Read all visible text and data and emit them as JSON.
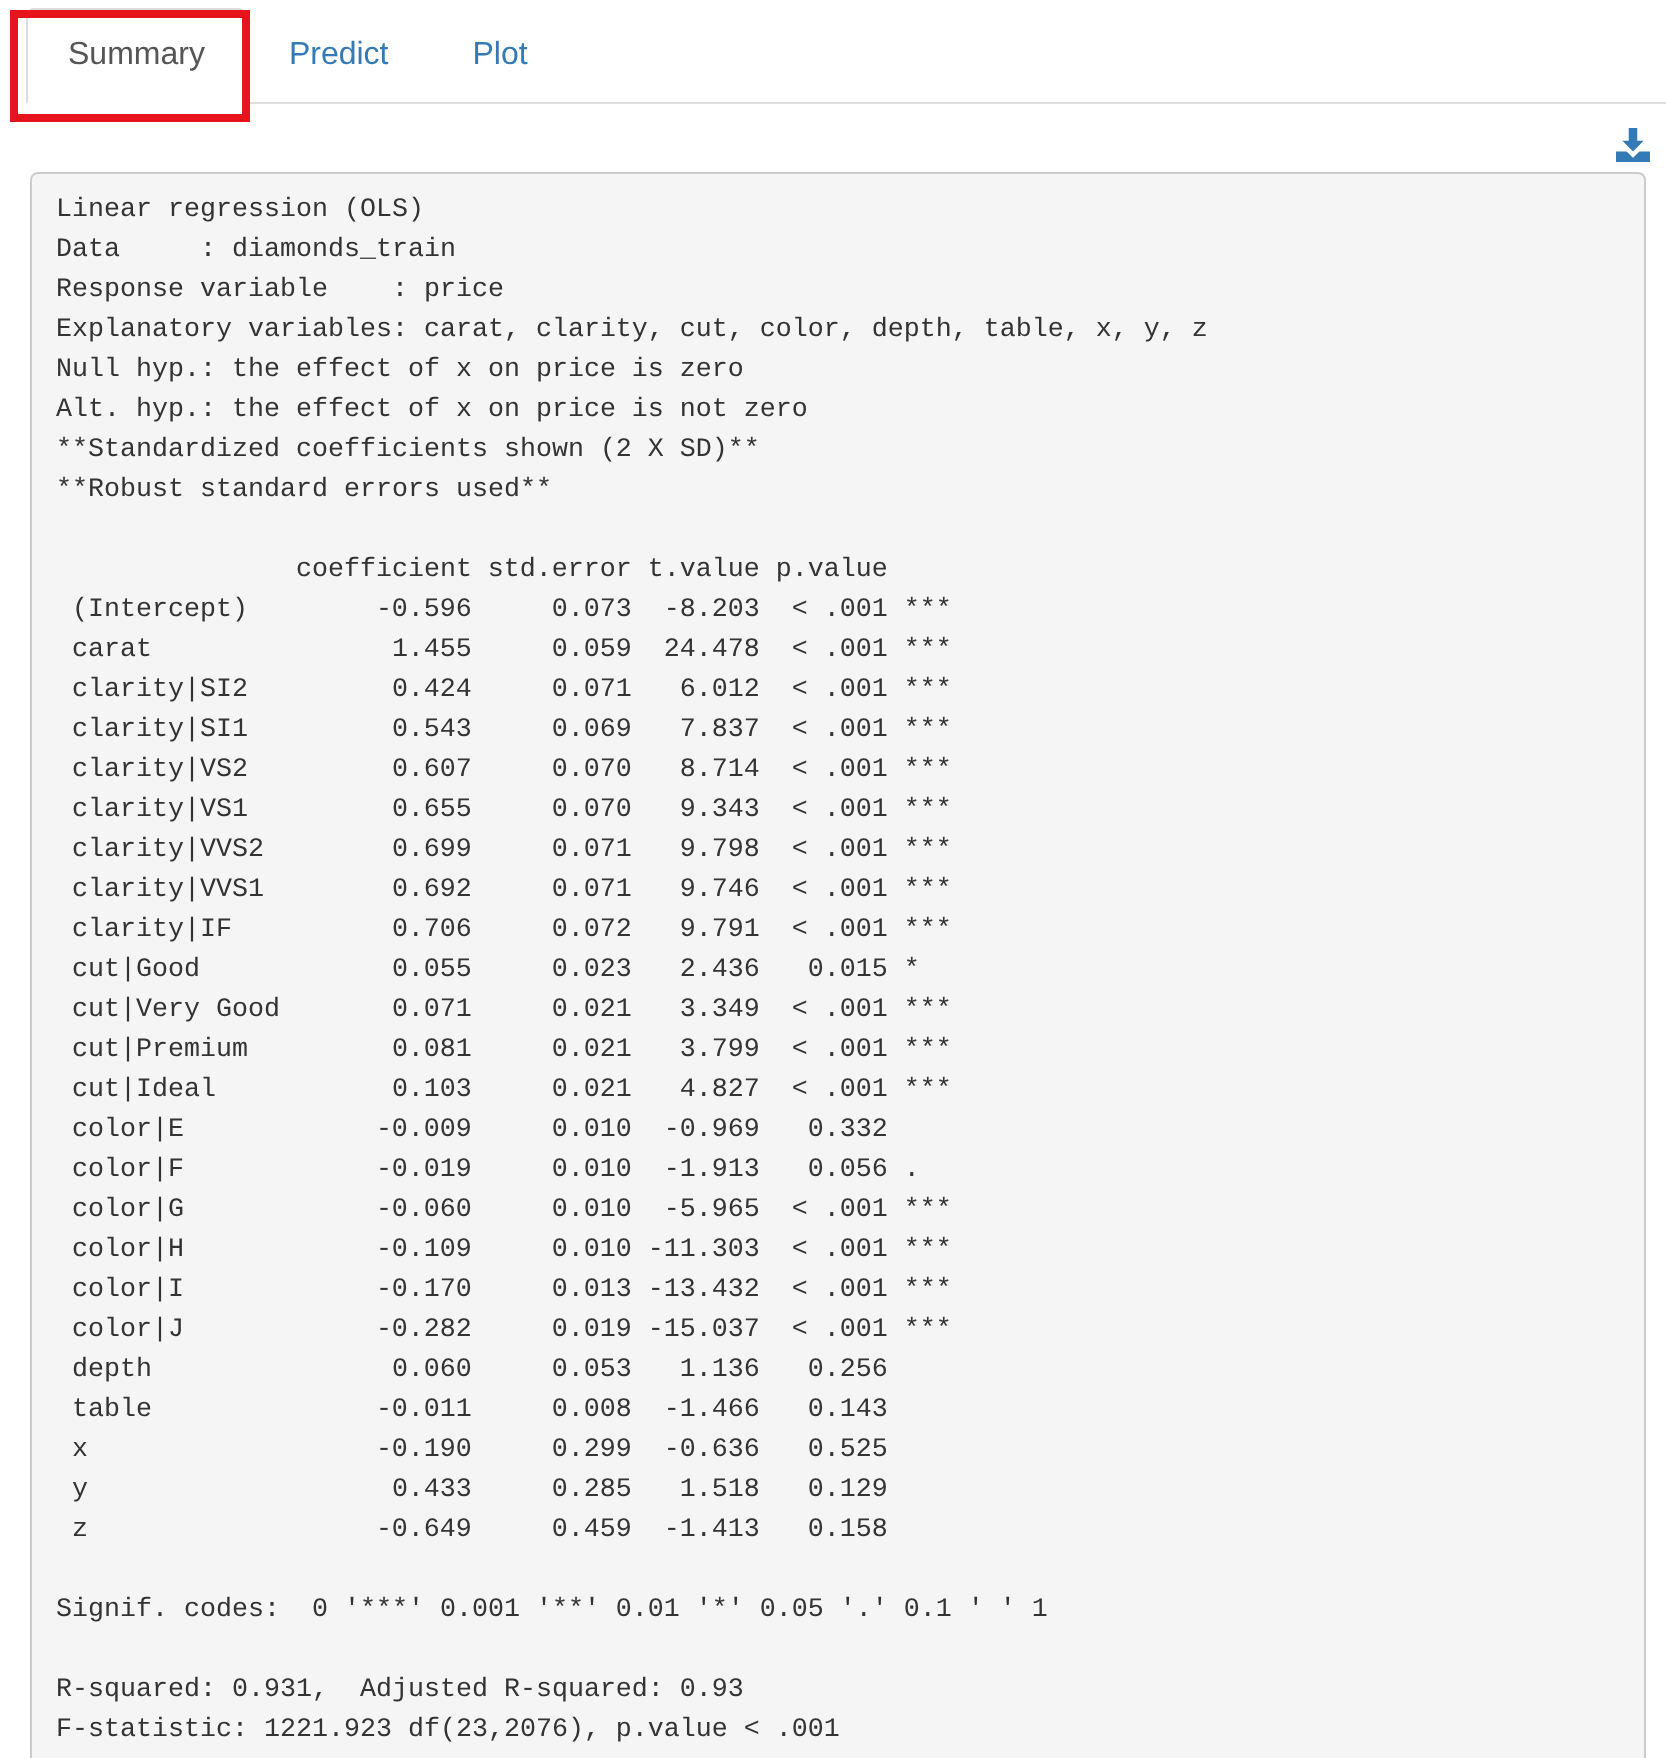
{
  "tabs": [
    {
      "label": "Summary",
      "selected": true,
      "highlighted": true
    },
    {
      "label": "Predict",
      "selected": false,
      "highlighted": false
    },
    {
      "label": "Plot",
      "selected": false,
      "highlighted": false
    }
  ],
  "output": {
    "header_lines": [
      "Linear regression (OLS)",
      "Data     : diamonds_train",
      "Response variable    : price",
      "Explanatory variables: carat, clarity, cut, color, depth, table, x, y, z",
      "Null hyp.: the effect of x on price is zero",
      "Alt. hyp.: the effect of x on price is not zero",
      "**Standardized coefficients shown (2 X SD)**",
      "**Robust standard errors used**"
    ],
    "table": {
      "columns": [
        "",
        "coefficient",
        "std.error",
        "t.value",
        "p.value",
        ""
      ],
      "rows": [
        [
          "(Intercept)",
          "-0.596",
          "0.073",
          "-8.203",
          "< .001",
          "***"
        ],
        [
          "carat",
          "1.455",
          "0.059",
          "24.478",
          "< .001",
          "***"
        ],
        [
          "clarity|SI2",
          "0.424",
          "0.071",
          "6.012",
          "< .001",
          "***"
        ],
        [
          "clarity|SI1",
          "0.543",
          "0.069",
          "7.837",
          "< .001",
          "***"
        ],
        [
          "clarity|VS2",
          "0.607",
          "0.070",
          "8.714",
          "< .001",
          "***"
        ],
        [
          "clarity|VS1",
          "0.655",
          "0.070",
          "9.343",
          "< .001",
          "***"
        ],
        [
          "clarity|VVS2",
          "0.699",
          "0.071",
          "9.798",
          "< .001",
          "***"
        ],
        [
          "clarity|VVS1",
          "0.692",
          "0.071",
          "9.746",
          "< .001",
          "***"
        ],
        [
          "clarity|IF",
          "0.706",
          "0.072",
          "9.791",
          "< .001",
          "***"
        ],
        [
          "cut|Good",
          "0.055",
          "0.023",
          "2.436",
          "0.015",
          "*"
        ],
        [
          "cut|Very Good",
          "0.071",
          "0.021",
          "3.349",
          "< .001",
          "***"
        ],
        [
          "cut|Premium",
          "0.081",
          "0.021",
          "3.799",
          "< .001",
          "***"
        ],
        [
          "cut|Ideal",
          "0.103",
          "0.021",
          "4.827",
          "< .001",
          "***"
        ],
        [
          "color|E",
          "-0.009",
          "0.010",
          "-0.969",
          "0.332",
          ""
        ],
        [
          "color|F",
          "-0.019",
          "0.010",
          "-1.913",
          "0.056",
          "."
        ],
        [
          "color|G",
          "-0.060",
          "0.010",
          "-5.965",
          "< .001",
          "***"
        ],
        [
          "color|H",
          "-0.109",
          "0.010",
          "-11.303",
          "< .001",
          "***"
        ],
        [
          "color|I",
          "-0.170",
          "0.013",
          "-13.432",
          "< .001",
          "***"
        ],
        [
          "color|J",
          "-0.282",
          "0.019",
          "-15.037",
          "< .001",
          "***"
        ],
        [
          "depth",
          "0.060",
          "0.053",
          "1.136",
          "0.256",
          ""
        ],
        [
          "table",
          "-0.011",
          "0.008",
          "-1.466",
          "0.143",
          ""
        ],
        [
          "x",
          "-0.190",
          "0.299",
          "-0.636",
          "0.525",
          ""
        ],
        [
          "y",
          "0.433",
          "0.285",
          "1.518",
          "0.129",
          ""
        ],
        [
          "z",
          "-0.649",
          "0.459",
          "-1.413",
          "0.158",
          ""
        ]
      ]
    },
    "signif_codes": "Signif. codes:  0 '***' 0.001 '**' 0.01 '*' 0.05 '.' 0.1 ' ' 1",
    "footer_lines": [
      "R-squared: 0.931,  Adjusted R-squared: 0.93",
      "F-statistic: 1221.923 df(23,2076), p.value < .001"
    ]
  }
}
